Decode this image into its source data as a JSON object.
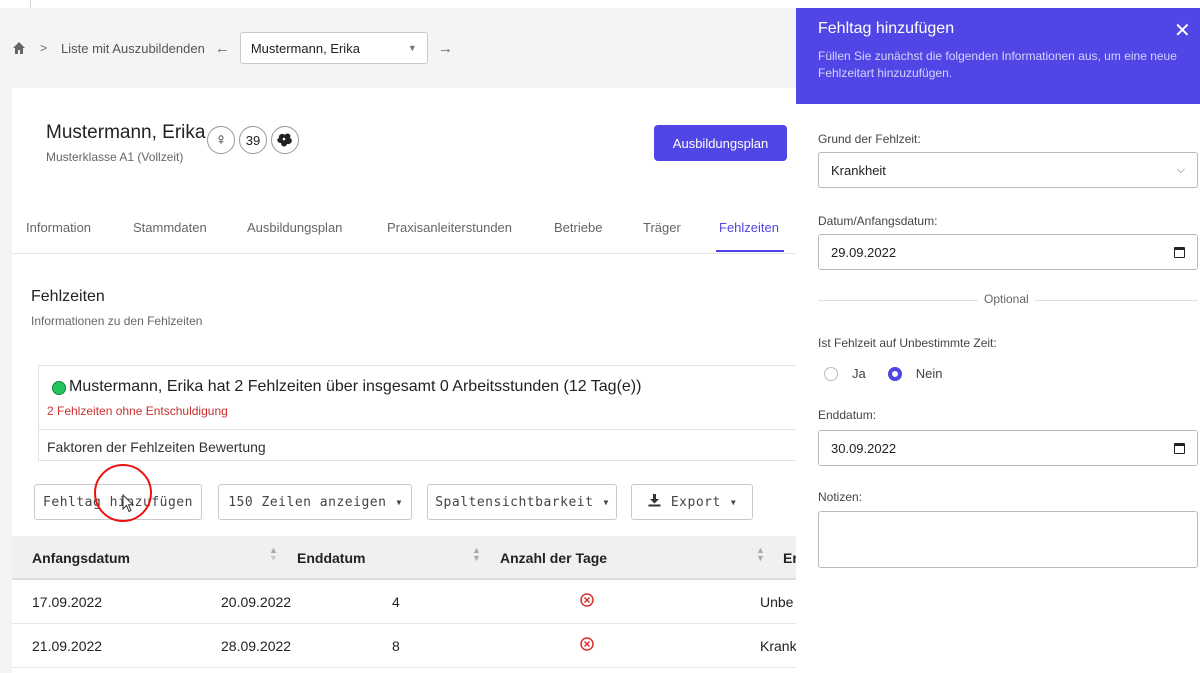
{
  "breadcrumb": {
    "list_label": "Liste mit Auszubildenden",
    "selected_student": "Mustermann, Erika"
  },
  "student": {
    "name": "Mustermann, Erika",
    "klasse": "Musterklasse A1 (Vollzeit)",
    "gender_symbol": "♀",
    "age": "39"
  },
  "plan_button_label": "Ausbildungsplan",
  "tabs": [
    {
      "label": "Information"
    },
    {
      "label": "Stammdaten"
    },
    {
      "label": "Ausbildungsplan"
    },
    {
      "label": "Praxisanleiterstunden"
    },
    {
      "label": "Betriebe"
    },
    {
      "label": "Träger"
    },
    {
      "label": "Fehlzeiten",
      "active": true
    }
  ],
  "section": {
    "title": "Fehlzeiten",
    "subtitle": "Informationen zu den Fehlzeiten"
  },
  "summary": {
    "main_text": "Mustermann, Erika hat 2 Fehlzeiten über insgesamt 0 Arbeitsstunden (12 Tag(e))",
    "warning": "2 Fehlzeiten ohne Entschuldigung",
    "factors_label": "Faktoren der Fehlzeiten Bewertung",
    "status_color": "#22c55e"
  },
  "toolbar": {
    "add_label": "Fehltag hinzufügen",
    "rows_label": "150 Zeilen anzeigen",
    "columns_label": "Spaltensichtbarkeit",
    "export_label": "Export"
  },
  "table": {
    "headers": [
      "Anfangsdatum",
      "Enddatum",
      "Anzahl der Tage",
      "Er"
    ],
    "rows": [
      {
        "start": "17.09.2022",
        "end": "20.09.2022",
        "days": "4",
        "excused_icon": "x-circle-icon",
        "reason": "Unbe"
      },
      {
        "start": "21.09.2022",
        "end": "28.09.2022",
        "days": "8",
        "excused_icon": "x-circle-icon",
        "reason": "Krank"
      }
    ]
  },
  "panel": {
    "title": "Fehltag hinzufügen",
    "description": "Füllen Sie zunächst die folgenden Informationen aus, um eine neue Fehlzeitart hinzuzufügen.",
    "reason_label": "Grund der Fehlzeit:",
    "reason_value": "Krankheit",
    "start_label": "Datum/Anfangsdatum:",
    "start_value": "29.09.2022",
    "optional_label": "Optional",
    "indefinite_label": "Ist Fehlzeit auf Unbestimmte Zeit:",
    "yes_label": "Ja",
    "no_label": "Nein",
    "end_label": "Enddatum:",
    "end_value": "30.09.2022",
    "notes_label": "Notizen:",
    "header_color": "#4f46e5"
  },
  "accent_color": "#5046e5"
}
